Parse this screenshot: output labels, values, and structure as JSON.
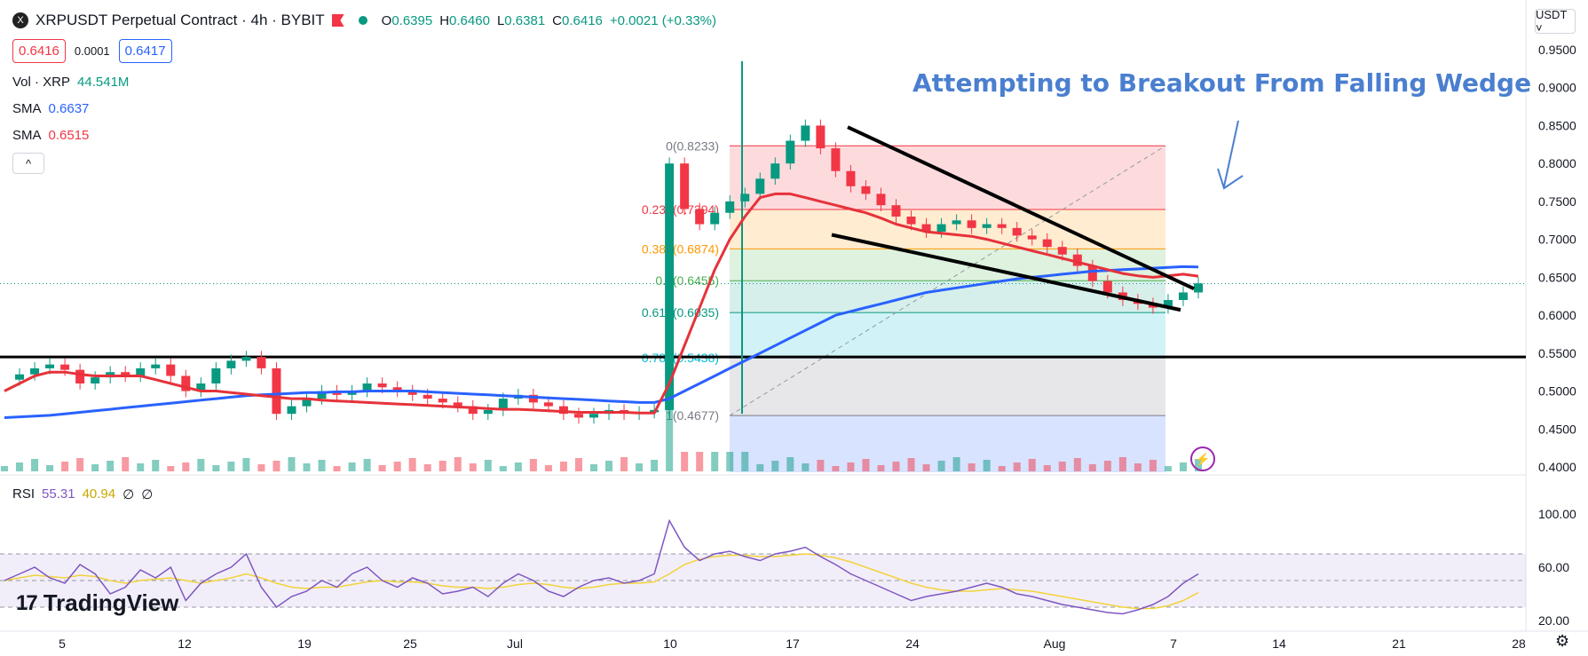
{
  "header": {
    "logo": "X",
    "title": "XRPUSDT Perpetual Contract · 4h · BYBIT",
    "o_k": "O",
    "o": "0.6395",
    "h_k": "H",
    "h": "0.6460",
    "l_k": "L",
    "l": "0.6381",
    "c_k": "C",
    "c": "0.6416",
    "chg": "+0.0021 (+0.33%)",
    "flag_icon": "red-flag-icon"
  },
  "price": {
    "bid": "0.6416",
    "spread": "0.0001",
    "ask": "0.6417"
  },
  "indicators": {
    "vol_label": "Vol · XRP",
    "vol_value": "44.541M",
    "sma1_label": "SMA",
    "sma1_value": "0.6637",
    "sma2_label": "SMA",
    "sma2_value": "0.6515",
    "collapse_icon": "^"
  },
  "rsi": {
    "label": "RSI",
    "v1": "55.31",
    "v2": "40.94",
    "v3": "∅",
    "v4": "∅"
  },
  "currency": "USDT ˅",
  "branding": {
    "mark": "17",
    "name": "TradingView"
  },
  "colors": {
    "up": "#089981",
    "down": "#f23645",
    "sma_red": "#e6323a",
    "sma_blue": "#2962ff",
    "rsi": "#7e57c2",
    "rsi_ma": "#f2d33a",
    "annotation": "#4a7fd0"
  },
  "chart_data": {
    "type": "candlestick",
    "symbol": "XRPUSDT",
    "timeframe": "4h",
    "price_axis": {
      "min": 0.4,
      "max": 0.95,
      "ticks": [
        "0.9500",
        "0.9000",
        "0.8500",
        "0.8000",
        "0.7500",
        "0.7000",
        "0.6500",
        "0.6000",
        "0.5500",
        "0.5000",
        "0.4500",
        "0.4000"
      ]
    },
    "x_axis": {
      "ticks": [
        "5",
        "12",
        "19",
        "25",
        "Jul",
        "10",
        "17",
        "24",
        "Aug",
        "7",
        "14",
        "21",
        "28"
      ]
    },
    "current_price": 0.6416,
    "annotation": "Attempting to Breakout From Falling Wedge",
    "fib_levels": [
      {
        "ratio": "0",
        "value": 0.8233,
        "label": "0(0.8233)"
      },
      {
        "ratio": "0.236",
        "value": 0.7394,
        "label": "0.236(0.7394)"
      },
      {
        "ratio": "0.382",
        "value": 0.6874,
        "label": "0.382(0.6874)"
      },
      {
        "ratio": "0.5",
        "value": 0.6455,
        "label": "0.5(0.6455)"
      },
      {
        "ratio": "0.618",
        "value": 0.6035,
        "label": "0.618(0.6035)"
      },
      {
        "ratio": "0.786",
        "value": 0.5438,
        "label": "0.786(0.5438)"
      },
      {
        "ratio": "1",
        "value": 0.4677,
        "label": "1(0.4677)"
      }
    ],
    "horizontal_support": 0.545,
    "price_series": [
      0.515,
      0.522,
      0.53,
      0.535,
      0.528,
      0.51,
      0.518,
      0.525,
      0.52,
      0.53,
      0.535,
      0.52,
      0.5,
      0.51,
      0.53,
      0.54,
      0.545,
      0.53,
      0.47,
      0.48,
      0.49,
      0.5,
      0.495,
      0.5,
      0.51,
      0.505,
      0.5,
      0.495,
      0.49,
      0.485,
      0.48,
      0.47,
      0.475,
      0.49,
      0.495,
      0.485,
      0.48,
      0.47,
      0.465,
      0.47,
      0.475,
      0.47,
      0.472,
      0.475,
      0.8,
      0.74,
      0.72,
      0.735,
      0.75,
      0.76,
      0.78,
      0.8,
      0.83,
      0.85,
      0.82,
      0.79,
      0.77,
      0.76,
      0.745,
      0.73,
      0.72,
      0.71,
      0.72,
      0.725,
      0.715,
      0.72,
      0.715,
      0.705,
      0.7,
      0.69,
      0.68,
      0.665,
      0.645,
      0.63,
      0.62,
      0.615,
      0.61,
      0.62,
      0.63,
      0.642
    ],
    "sma_red_series": [
      0.5,
      0.51,
      0.52,
      0.525,
      0.525,
      0.522,
      0.52,
      0.52,
      0.52,
      0.52,
      0.515,
      0.51,
      0.505,
      0.5,
      0.5,
      0.498,
      0.496,
      0.494,
      0.492,
      0.49,
      0.49,
      0.488,
      0.487,
      0.486,
      0.485,
      0.484,
      0.483,
      0.482,
      0.481,
      0.48,
      0.479,
      0.478,
      0.477,
      0.476,
      0.476,
      0.475,
      0.474,
      0.473,
      0.472,
      0.472,
      0.472,
      0.472,
      0.471,
      0.471,
      0.51,
      0.56,
      0.61,
      0.66,
      0.7,
      0.73,
      0.755,
      0.76,
      0.76,
      0.755,
      0.75,
      0.745,
      0.74,
      0.735,
      0.728,
      0.72,
      0.715,
      0.71,
      0.708,
      0.706,
      0.704,
      0.7,
      0.695,
      0.69,
      0.685,
      0.68,
      0.675,
      0.67,
      0.665,
      0.66,
      0.655,
      0.652,
      0.65,
      0.652,
      0.654,
      0.6515
    ],
    "sma_blue_series": [
      0.465,
      0.466,
      0.467,
      0.468,
      0.47,
      0.472,
      0.474,
      0.476,
      0.478,
      0.48,
      0.482,
      0.484,
      0.486,
      0.488,
      0.49,
      0.492,
      0.494,
      0.495,
      0.496,
      0.497,
      0.498,
      0.498,
      0.499,
      0.499,
      0.5,
      0.5,
      0.5,
      0.5,
      0.499,
      0.498,
      0.497,
      0.496,
      0.495,
      0.494,
      0.493,
      0.492,
      0.491,
      0.49,
      0.489,
      0.488,
      0.487,
      0.486,
      0.485,
      0.485,
      0.49,
      0.5,
      0.51,
      0.52,
      0.53,
      0.54,
      0.55,
      0.56,
      0.57,
      0.58,
      0.59,
      0.6,
      0.605,
      0.61,
      0.615,
      0.62,
      0.625,
      0.63,
      0.633,
      0.636,
      0.639,
      0.642,
      0.645,
      0.648,
      0.65,
      0.652,
      0.654,
      0.656,
      0.658,
      0.659,
      0.66,
      0.661,
      0.662,
      0.663,
      0.664,
      0.6637
    ],
    "rsi_axis": {
      "ticks": [
        "100.00",
        "60.00",
        "20.00"
      ]
    },
    "rsi_series": [
      50,
      55,
      60,
      52,
      48,
      62,
      55,
      40,
      45,
      58,
      52,
      60,
      35,
      48,
      55,
      60,
      70,
      45,
      30,
      38,
      42,
      50,
      45,
      55,
      60,
      50,
      45,
      52,
      48,
      40,
      42,
      45,
      38,
      48,
      55,
      50,
      42,
      38,
      45,
      50,
      52,
      48,
      50,
      55,
      95,
      75,
      65,
      70,
      72,
      68,
      65,
      70,
      72,
      75,
      68,
      62,
      55,
      50,
      45,
      40,
      35,
      38,
      40,
      42,
      45,
      48,
      45,
      40,
      38,
      35,
      32,
      30,
      28,
      26,
      25,
      28,
      32,
      38,
      48,
      55
    ],
    "rsi_ma_series": [
      50,
      52,
      54,
      53,
      52,
      54,
      53,
      50,
      48,
      50,
      51,
      52,
      50,
      48,
      50,
      52,
      55,
      52,
      48,
      45,
      44,
      45,
      45,
      47,
      49,
      50,
      49,
      49,
      48,
      46,
      45,
      45,
      44,
      45,
      47,
      48,
      47,
      45,
      44,
      45,
      47,
      48,
      48,
      49,
      55,
      62,
      66,
      68,
      69,
      69,
      68,
      68,
      69,
      70,
      69,
      67,
      64,
      60,
      56,
      52,
      48,
      45,
      43,
      42,
      42,
      43,
      44,
      43,
      42,
      40,
      38,
      36,
      34,
      32,
      30,
      29,
      29,
      31,
      35,
      40.94
    ]
  }
}
